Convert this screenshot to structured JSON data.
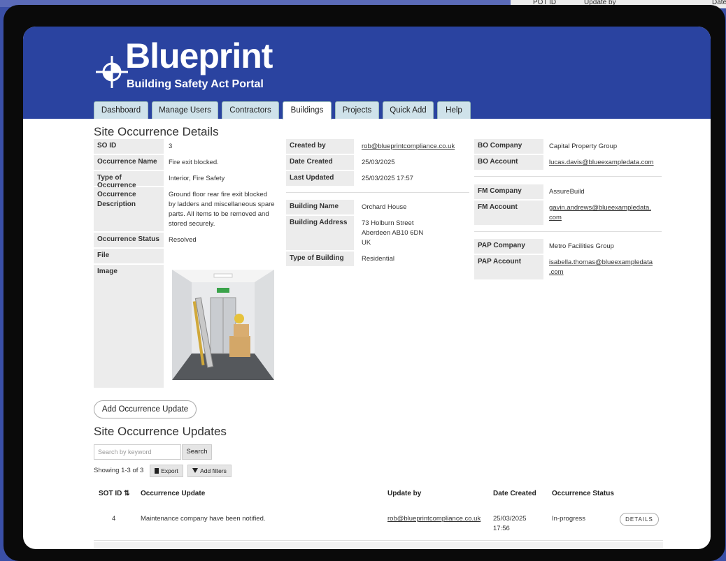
{
  "bg": {
    "col1": "POT ID",
    "col2": "Update by",
    "col3": "Date"
  },
  "brand": {
    "name": "Blueprint",
    "tagline": "Building Safety Act Portal"
  },
  "tabs": [
    "Dashboard",
    "Manage Users",
    "Contractors",
    "Buildings",
    "Projects",
    "Quick Add",
    "Help"
  ],
  "active_tab": "Buildings",
  "details": {
    "title": "Site Occurrence Details",
    "so_id": {
      "label": "SO ID",
      "value": "3"
    },
    "name": {
      "label": "Occurrence Name",
      "value": "Fire exit blocked."
    },
    "type": {
      "label": "Type of Occurrence",
      "value": "Interior, Fire Safety"
    },
    "description": {
      "label1": "Occurrence",
      "label2": "Description",
      "lines": [
        "Ground floor rear fire exit blocked",
        "by ladders and miscellaneous spare",
        "parts. All items to be removed and",
        "stored securely."
      ]
    },
    "status": {
      "label": "Occurrence Status",
      "value": "Resolved"
    },
    "file": {
      "label": "File"
    },
    "image": {
      "label": "Image"
    }
  },
  "meta": {
    "created_by": {
      "label": "Created by",
      "value": "rob@blueprintcompliance.co.uk"
    },
    "date_created": {
      "label": "Date Created",
      "value": "25/03/2025"
    },
    "last_updated": {
      "label": "Last Updated",
      "value": "25/03/2025 17:57"
    },
    "building_name": {
      "label": "Building Name",
      "value": "Orchard House"
    },
    "building_address": {
      "label": "Building Address",
      "lines": [
        "73 Holburn Street",
        "Aberdeen AB10 6DN",
        "UK"
      ]
    },
    "building_type": {
      "label": "Type of Building",
      "value": "Residential"
    }
  },
  "companies": {
    "bo_company": {
      "label": "BO Company",
      "value": "Capital Property Group"
    },
    "bo_account": {
      "label": "BO Account",
      "value": "lucas.davis@blueexampledata.com"
    },
    "fm_company": {
      "label": "FM Company",
      "value": "AssureBuild"
    },
    "fm_account": {
      "label": "FM Account",
      "lines": [
        "gavin.andrews@blueexampledata.",
        "com"
      ]
    },
    "pap_company": {
      "label": "PAP Company",
      "value": "Metro Facilities Group"
    },
    "pap_account": {
      "label": "PAP Account",
      "lines": [
        "isabella.thomas@blueexampledata",
        ".com"
      ]
    }
  },
  "add_update_button": "Add Occurrence Update",
  "updates": {
    "title": "Site Occurrence Updates",
    "search_placeholder": "Search by keyword",
    "search_button": "Search",
    "showing": "Showing 1-3 of 3",
    "export": "Export",
    "add_filters": "Add filters",
    "columns": [
      "SOT ID",
      "Occurrence Update",
      "Update by",
      "Date Created",
      "Occurrence Status"
    ],
    "rows": [
      {
        "id": "4",
        "update": "Maintenance company have been notified.",
        "by": "rob@blueprintcompliance.co.uk",
        "date1": "25/03/2025",
        "date2": "17:56",
        "status": "In-progress",
        "action": "DETAILS"
      }
    ]
  },
  "colors": {
    "header": "#2a43a0",
    "tab": "#cfe2ea",
    "label_bg": "#ececec"
  }
}
